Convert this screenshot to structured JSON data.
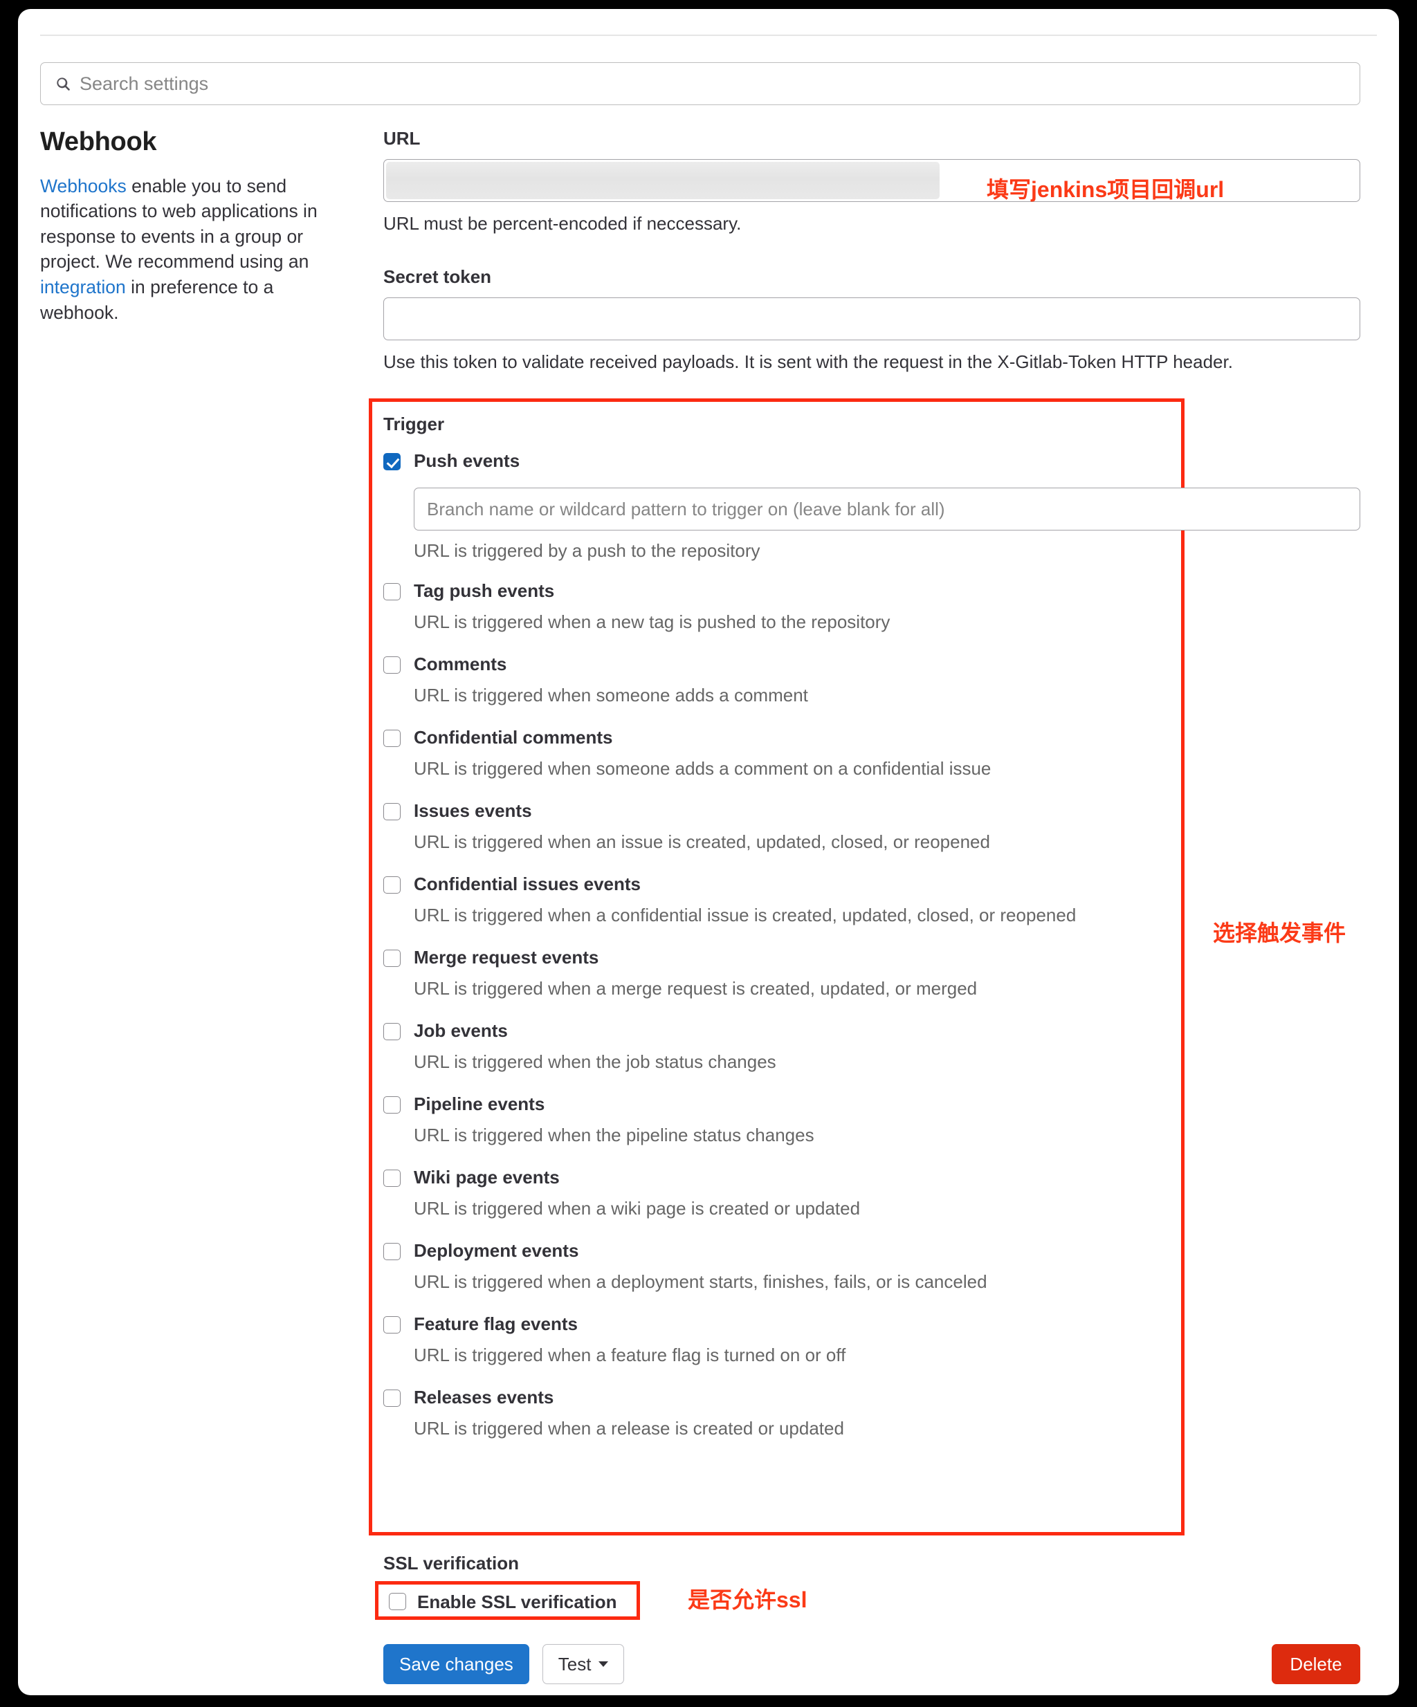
{
  "search": {
    "placeholder": "Search settings",
    "value": "",
    "icon": "search-icon"
  },
  "sidebar": {
    "title": "Webhook",
    "description_parts": {
      "link1": "Webhooks",
      "text1": " enable you to send notifications to web applications in response to events in a group or project. We recommend using an ",
      "link2": "integration",
      "text2": " in preference to a webhook."
    }
  },
  "form": {
    "url": {
      "label": "URL",
      "value": "",
      "help": "URL must be percent-encoded if neccessary.",
      "redacted": true
    },
    "secret_token": {
      "label": "Secret token",
      "value": "",
      "help": "Use this token to validate received payloads. It is sent with the request in the X-Gitlab-Token HTTP header."
    }
  },
  "trigger": {
    "heading": "Trigger",
    "branch_input": {
      "placeholder": "Branch name or wildcard pattern to trigger on (leave blank for all)",
      "value": ""
    },
    "items": [
      {
        "label": "Push events",
        "desc": "URL is triggered by a push to the repository",
        "checked": true,
        "has_branch_input": true
      },
      {
        "label": "Tag push events",
        "desc": "URL is triggered when a new tag is pushed to the repository",
        "checked": false
      },
      {
        "label": "Comments",
        "desc": "URL is triggered when someone adds a comment",
        "checked": false
      },
      {
        "label": "Confidential comments",
        "desc": "URL is triggered when someone adds a comment on a confidential issue",
        "checked": false
      },
      {
        "label": "Issues events",
        "desc": "URL is triggered when an issue is created, updated, closed, or reopened",
        "checked": false
      },
      {
        "label": "Confidential issues events",
        "desc": "URL is triggered when a confidential issue is created, updated, closed, or reopened",
        "checked": false
      },
      {
        "label": "Merge request events",
        "desc": "URL is triggered when a merge request is created, updated, or merged",
        "checked": false
      },
      {
        "label": "Job events",
        "desc": "URL is triggered when the job status changes",
        "checked": false
      },
      {
        "label": "Pipeline events",
        "desc": "URL is triggered when the pipeline status changes",
        "checked": false
      },
      {
        "label": "Wiki page events",
        "desc": "URL is triggered when a wiki page is created or updated",
        "checked": false
      },
      {
        "label": "Deployment events",
        "desc": "URL is triggered when a deployment starts, finishes, fails, or is canceled",
        "checked": false
      },
      {
        "label": "Feature flag events",
        "desc": "URL is triggered when a feature flag is turned on or off",
        "checked": false
      },
      {
        "label": "Releases events",
        "desc": "URL is triggered when a release is created or updated",
        "checked": false
      }
    ]
  },
  "ssl": {
    "label": "SSL verification",
    "checkbox_label": "Enable SSL verification",
    "checked": false
  },
  "buttons": {
    "save": "Save changes",
    "test": "Test",
    "delete": "Delete"
  },
  "annotations": {
    "url_note": "填写jenkins项目回调url",
    "trigger_note": "选择触发事件",
    "ssl_note": "是否允许ssl"
  },
  "colors": {
    "accent_blue": "#1f75cb",
    "danger_red": "#dd2b0e",
    "annotation_red": "#fc2a11",
    "link_blue": "#1f75cb"
  }
}
